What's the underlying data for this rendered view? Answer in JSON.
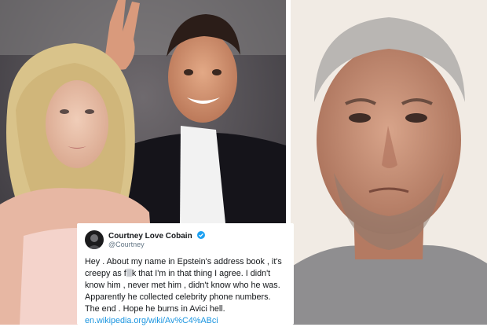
{
  "tweet": {
    "display_name": "Courtney Love Cobain",
    "handle": "@Courtney",
    "text_part1": "Hey . About my name in Epstein's address book , it's creepy as f",
    "text_part2": "k that I'm in that thing I agree. I didn't know him , never met him , didn't know who he was. Apparently he collected celebrity phone numbers. The end . Hope he burns in Avici hell.",
    "link": "en.wikipedia.org/wiki/Av%C4%ABci",
    "link_color": "#1b95e0",
    "verified_color": "#1da1f2"
  },
  "icons": {
    "verified": "verified-badge-icon",
    "avatar": "user-avatar"
  }
}
